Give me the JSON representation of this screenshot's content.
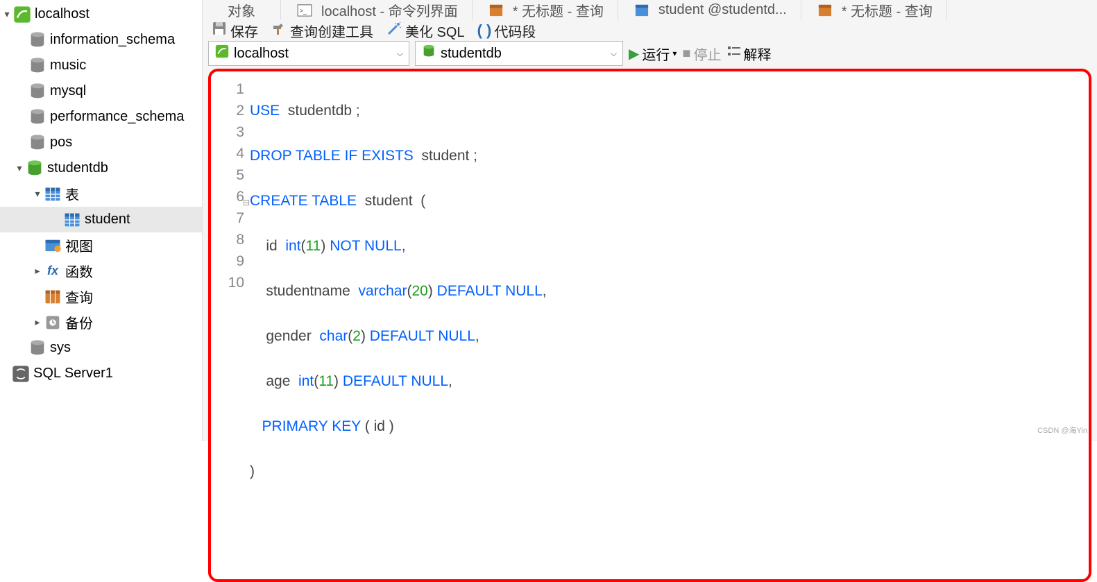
{
  "tree": {
    "root": "localhost",
    "databases": [
      "information_schema",
      "music",
      "mysql",
      "performance_schema",
      "pos"
    ],
    "open_db": "studentdb",
    "open_db_children": {
      "tables_label": "表",
      "table": "student",
      "views": "视图",
      "functions": "函数",
      "queries": "查询",
      "backups": "备份"
    },
    "last_db": "sys",
    "server2": "SQL Server1"
  },
  "tabs": {
    "t0": "对象",
    "t1": "localhost - 命令列界面",
    "t2": "* 无标题 - 查询",
    "t3": "student @studentd...",
    "t4": "* 无标题 - 查询"
  },
  "toolbar": {
    "save": "保存",
    "builder": "查询创建工具",
    "beautify": "美化 SQL",
    "snippet": "代码段"
  },
  "selectors": {
    "conn": "localhost",
    "db": "studentdb",
    "run": "运行",
    "stop": "停止",
    "explain": "解释"
  },
  "code": {
    "l1_kw": "USE",
    "l1_rest": "  studentdb ;",
    "l2_a": "DROP",
    "l2_b": "TABLE",
    "l2_c": "IF",
    "l2_d": "EXISTS",
    "l2_rest": "  student ;",
    "l3_a": "CREATE",
    "l3_b": "TABLE",
    "l3_rest": "  student  (",
    "l4_id": "    id  ",
    "l4_int": "int",
    "l4_p1": "(",
    "l4_11": "11",
    "l4_p2": ") ",
    "l4_nn1": "NOT",
    "l4_nn2": "NULL",
    "l4_end": ",",
    "l5_name": "    studentname  ",
    "l5_vc": "varchar",
    "l5_p1": "(",
    "l5_20": "20",
    "l5_p2": ") ",
    "l5_d": "DEFAULT",
    "l5_n": "NULL",
    "l5_end": ",",
    "l6_g": "    gender  ",
    "l6_ch": "char",
    "l6_p1": "(",
    "l6_2": "2",
    "l6_p2": ") ",
    "l6_d": "DEFAULT",
    "l6_n": "NULL",
    "l6_end": ",",
    "l7_a": "    age  ",
    "l7_int": "int",
    "l7_p1": "(",
    "l7_11": "11",
    "l7_p2": ") ",
    "l7_d": "DEFAULT",
    "l7_n": "NULL",
    "l7_end": ",",
    "l8_a": "   ",
    "l8_pk1": "PRIMARY",
    "l8_pk2": "KEY",
    "l8_rest": " ( id )",
    "l9": ")"
  },
  "lines": {
    "n1": "1",
    "n2": "2",
    "n3": "3",
    "n4": "4",
    "n5": "5",
    "n6": "6",
    "n7": "7",
    "n8": "8",
    "n9": "9",
    "n10": "10"
  },
  "watermark": "CSDN @海Yin"
}
